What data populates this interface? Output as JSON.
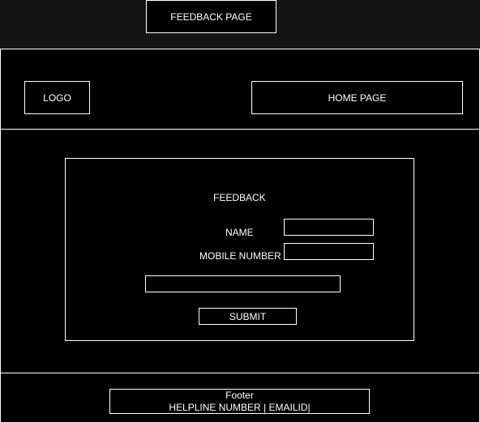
{
  "page_title": "FEEDBACK PAGE",
  "header": {
    "logo": "LOGO",
    "home_link": "HOME PAGE"
  },
  "form": {
    "title": "FEEDBACK",
    "name_label": "NAME",
    "name_value": "",
    "mobile_label": "MOBILE NUMBER",
    "mobile_value": "",
    "feedback_value": "",
    "submit_label": "SUBMIT"
  },
  "footer": {
    "title": "Footer",
    "info": "HELPLINE NUMBER | EMAILID|"
  }
}
